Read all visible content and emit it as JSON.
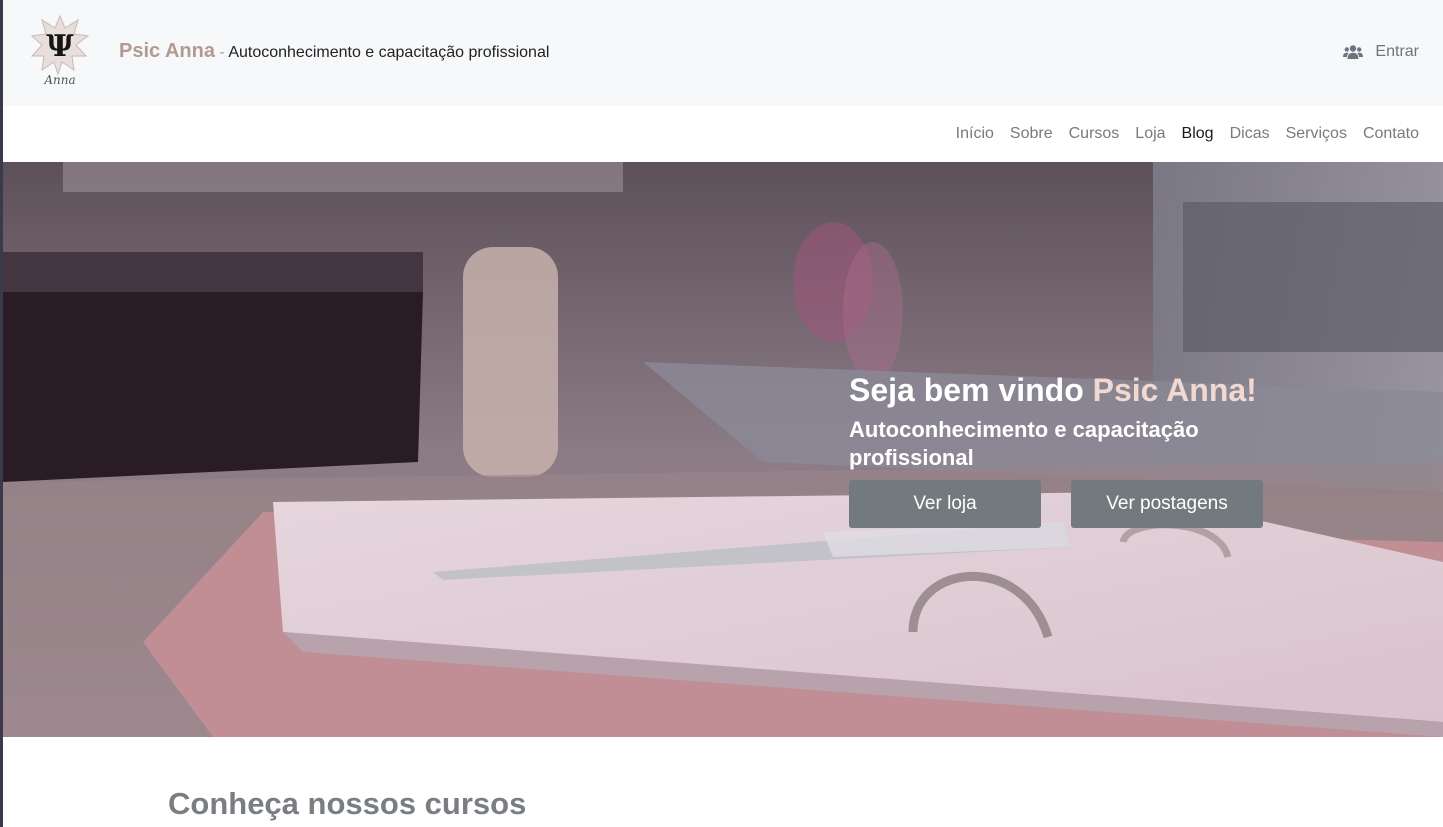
{
  "header": {
    "brand_name": "Psic Anna",
    "brand_separator": " - ",
    "brand_tagline": "Autoconhecimento e capacitação profissional",
    "logo_text": "Anna",
    "logo_icon": "psi-star-logo",
    "login_label": "Entrar",
    "login_icon": "users-icon"
  },
  "nav": {
    "items": [
      {
        "label": "Início",
        "active": false
      },
      {
        "label": "Sobre",
        "active": false
      },
      {
        "label": "Cursos",
        "active": false
      },
      {
        "label": "Loja",
        "active": false
      },
      {
        "label": "Blog",
        "active": true
      },
      {
        "label": "Dicas",
        "active": false
      },
      {
        "label": "Serviços",
        "active": false
      },
      {
        "label": "Contato",
        "active": false
      }
    ]
  },
  "hero": {
    "title_prefix": "Seja bem vindo ",
    "title_accent": "Psic Anna!",
    "subtitle": "Autoconhecimento e capacitação profissional",
    "buttons": {
      "shop_label": "Ver loja",
      "posts_label": "Ver postagens"
    }
  },
  "courses_section": {
    "title": "Conheça nossos cursos"
  },
  "colors": {
    "brand": "#b29a93",
    "button_bg": "#737a7e",
    "accent_text": "#f1d8d0"
  }
}
